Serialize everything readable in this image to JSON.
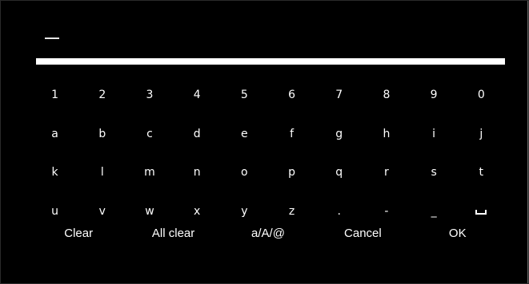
{
  "keyboard": {
    "rows": [
      [
        "1",
        "2",
        "3",
        "4",
        "5",
        "6",
        "7",
        "8",
        "9",
        "0"
      ],
      [
        "a",
        "b",
        "c",
        "d",
        "e",
        "f",
        "g",
        "h",
        "i",
        "j"
      ],
      [
        "k",
        "l",
        "m",
        "n",
        "o",
        "p",
        "q",
        "r",
        "s",
        "t"
      ],
      [
        "u",
        "v",
        "w",
        "x",
        "y",
        "z",
        ".",
        "-",
        "_",
        ""
      ]
    ],
    "space_icon": "space-bar-icon"
  },
  "actions": {
    "clear": "Clear",
    "all_clear": "All clear",
    "mode": "a/A/@",
    "cancel": "Cancel",
    "ok": "OK"
  }
}
